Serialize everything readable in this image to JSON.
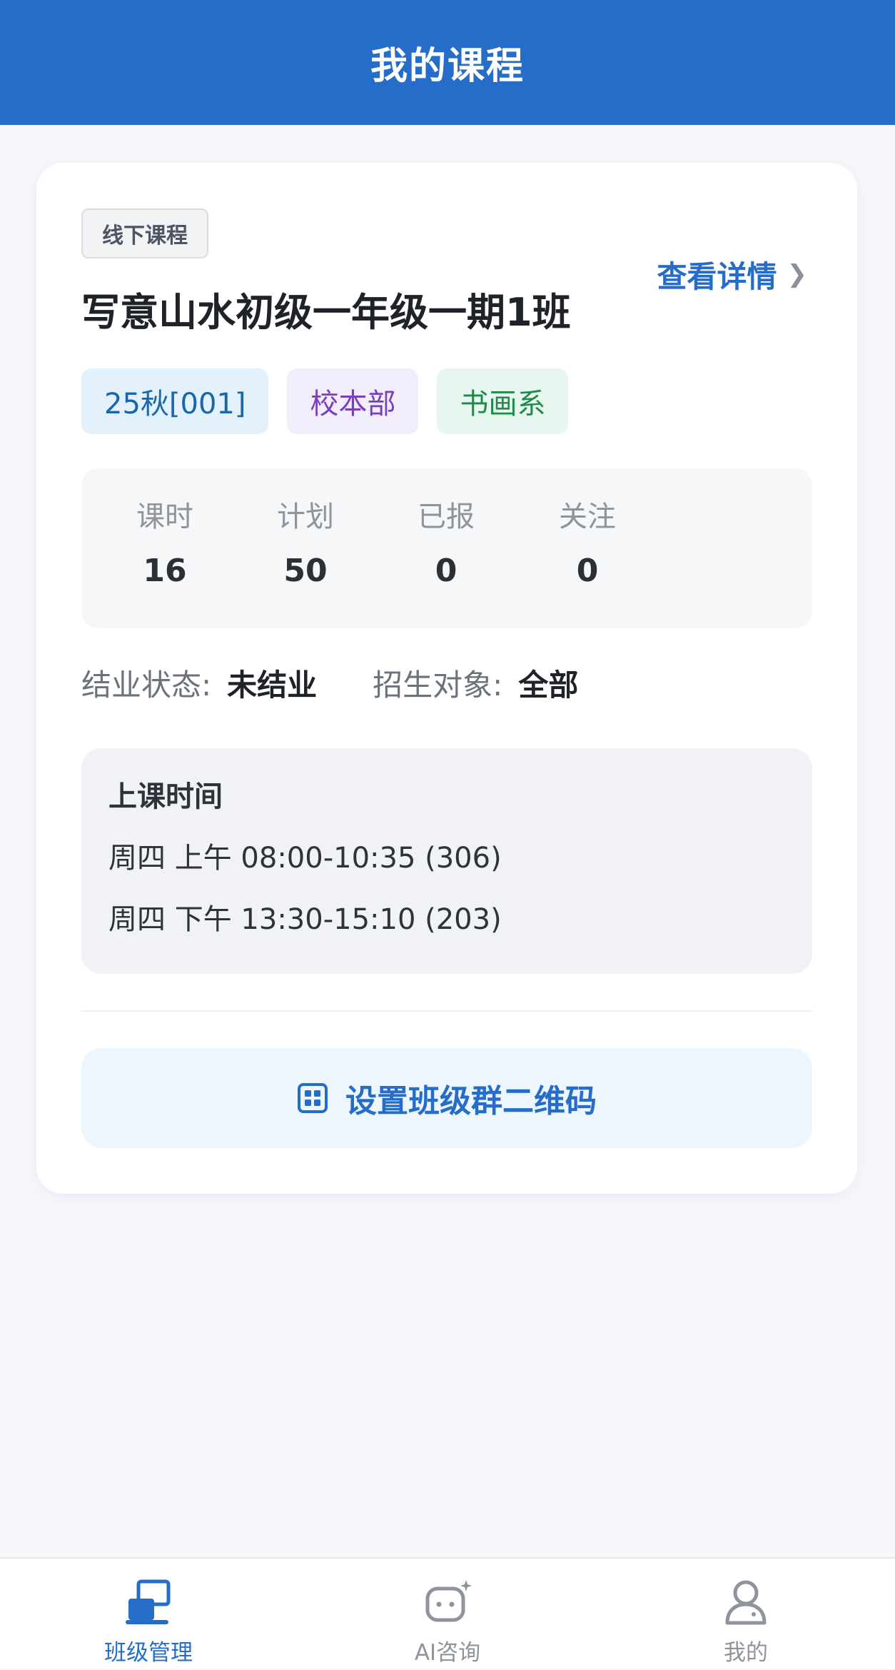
{
  "header": {
    "title": "我的课程"
  },
  "course": {
    "type_tag": "线下课程",
    "title": "写意山水初级一年级一期1班",
    "detail_link": "查看详情",
    "badges": [
      {
        "label": "25秋[001]",
        "color": "#1a66a6"
      },
      {
        "label": "校本部",
        "color": "#7a3fbf"
      },
      {
        "label": "书画系",
        "color": "#1f8a4c"
      }
    ],
    "stats": [
      {
        "label": "课时",
        "value": "16"
      },
      {
        "label": "计划",
        "value": "50"
      },
      {
        "label": "已报",
        "value": "0"
      },
      {
        "label": "关注",
        "value": "0"
      }
    ],
    "meta": {
      "completion_label": "结业状态:",
      "completion_value": "未结业",
      "audience_label": "招生对象:",
      "audience_value": "全部"
    },
    "schedule": {
      "title": "上课时间",
      "lines": [
        "周四 上午 08:00-10:35 (306)",
        "周四 下午 13:30-15:10 (203)"
      ]
    },
    "qr_button": {
      "label": "设置班级群二维码",
      "icon": "qr-grid-icon"
    }
  },
  "tabbar": {
    "active_color": "#256dc8",
    "items": [
      {
        "label": "班级管理",
        "icon": "class-management-icon",
        "active": true
      },
      {
        "label": "AI咨询",
        "icon": "ai-chat-icon",
        "active": false
      },
      {
        "label": "我的",
        "icon": "profile-icon",
        "active": false
      }
    ]
  }
}
